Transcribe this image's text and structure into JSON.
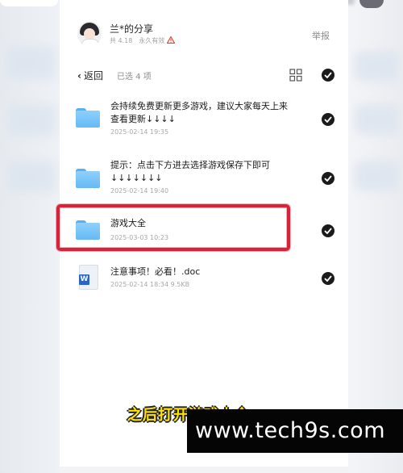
{
  "share": {
    "title": "兰*的分享",
    "meta_text": "共 4.18",
    "validity": "永久有效",
    "report_label": "举报"
  },
  "toolbar": {
    "back_label": "返回",
    "selected_label": "已选 4 项"
  },
  "files": [
    {
      "name": "会持续免费更新更多游戏，建议大家每天上来查看更新↓↓↓↓",
      "date": "2025-02-14 19:35",
      "type": "folder",
      "selected": true
    },
    {
      "name": "提示：点击下方进去选择游戏保存下即可↓↓↓↓↓↓↓",
      "date": "2025-02-14 19:40",
      "type": "folder",
      "selected": true
    },
    {
      "name": "游戏大全",
      "date": "2025-03-03 10:23",
      "type": "folder",
      "selected": true,
      "highlighted": true
    },
    {
      "name": "注意事项！必看！.doc",
      "date": "2025-02-14 18:34",
      "size": "9.5KB",
      "type": "doc",
      "selected": true
    }
  ],
  "icons": {
    "doc_badge": "W"
  },
  "caption": "之后打开游戏大全",
  "watermark": "www.tech9s.com",
  "colors": {
    "highlight": "#d7233a",
    "folder": "#64b9f5",
    "caption": "#ffe300"
  }
}
